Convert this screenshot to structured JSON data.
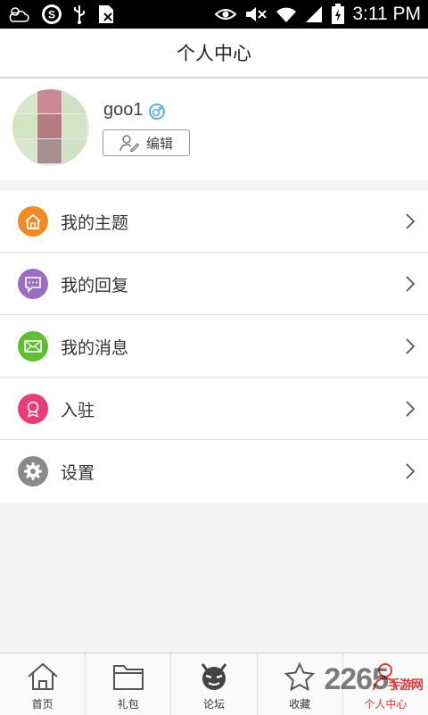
{
  "status_bar": {
    "time": "3:11 PM",
    "icons": [
      "weather-icon",
      "s-app-icon",
      "usb-icon",
      "no-sim-icon",
      "eye-icon",
      "mute-icon",
      "wifi-icon",
      "signal-icon",
      "battery-icon"
    ]
  },
  "header": {
    "title": "个人中心"
  },
  "profile": {
    "username": "goo1",
    "gender_icon": "male-icon",
    "edit_label": "编辑"
  },
  "menu": {
    "items": [
      {
        "label": "我的主题",
        "icon": "home-icon",
        "color": "#f08a24"
      },
      {
        "label": "我的回复",
        "icon": "chat-icon",
        "color": "#9b6fc0"
      },
      {
        "label": "我的消息",
        "icon": "mail-icon",
        "color": "#5fbf33"
      },
      {
        "label": "入驻",
        "icon": "badge-icon",
        "color": "#ea3d78"
      },
      {
        "label": "设置",
        "icon": "gear-icon",
        "color": "#8a8a8a"
      }
    ]
  },
  "tabbar": {
    "tabs": [
      {
        "label": "首页",
        "icon": "home-outline-icon"
      },
      {
        "label": "礼包",
        "icon": "folder-icon"
      },
      {
        "label": "论坛",
        "icon": "devil-icon"
      },
      {
        "label": "收藏",
        "icon": "star-icon"
      },
      {
        "label": "个人中心",
        "icon": "person-icon",
        "active": true
      }
    ]
  },
  "watermark": {
    "text": "2265",
    "suffix": "手游网"
  }
}
